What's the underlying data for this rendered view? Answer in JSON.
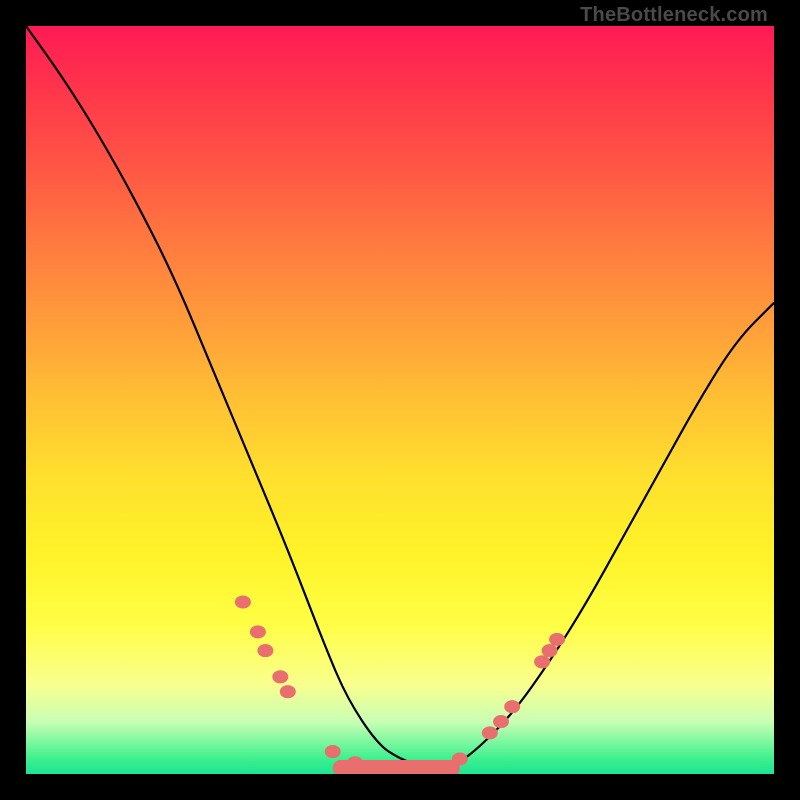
{
  "watermark": "TheBottleneck.com",
  "chart_data": {
    "type": "line",
    "title": "",
    "xlabel": "",
    "ylabel": "",
    "xlim": [
      0,
      100
    ],
    "ylim": [
      0,
      100
    ],
    "grid": false,
    "series": [
      {
        "name": "curve",
        "color": "#000000",
        "x": [
          0,
          5,
          10,
          15,
          20,
          25,
          30,
          35,
          40,
          43,
          47,
          50,
          53,
          57,
          60,
          65,
          70,
          75,
          80,
          85,
          90,
          95,
          100
        ],
        "y": [
          100,
          93,
          85,
          76,
          66,
          54,
          42,
          30,
          17,
          10,
          4,
          2,
          1,
          1,
          3,
          8,
          15,
          23,
          32,
          41,
          50,
          58,
          63
        ]
      }
    ],
    "markers": [
      {
        "name": "scatter-points",
        "color": "#e96f6f",
        "radius": 8,
        "points": [
          {
            "x": 29,
            "y": 23
          },
          {
            "x": 31,
            "y": 19
          },
          {
            "x": 32,
            "y": 16.5
          },
          {
            "x": 34,
            "y": 13
          },
          {
            "x": 35,
            "y": 11
          },
          {
            "x": 41,
            "y": 3
          },
          {
            "x": 44,
            "y": 1.5
          },
          {
            "x": 48,
            "y": 0.8
          },
          {
            "x": 50,
            "y": 0.8
          },
          {
            "x": 53,
            "y": 0.8
          },
          {
            "x": 54,
            "y": 1.0
          },
          {
            "x": 58,
            "y": 2.0
          },
          {
            "x": 62,
            "y": 5.5
          },
          {
            "x": 63.5,
            "y": 7
          },
          {
            "x": 65,
            "y": 9
          },
          {
            "x": 69,
            "y": 15
          },
          {
            "x": 70,
            "y": 16.5
          },
          {
            "x": 71,
            "y": 18
          }
        ]
      }
    ],
    "bottom_bar": {
      "color": "#e96f6f",
      "x_start": 41,
      "x_end": 58,
      "y": 0.8,
      "thickness": 16
    }
  }
}
